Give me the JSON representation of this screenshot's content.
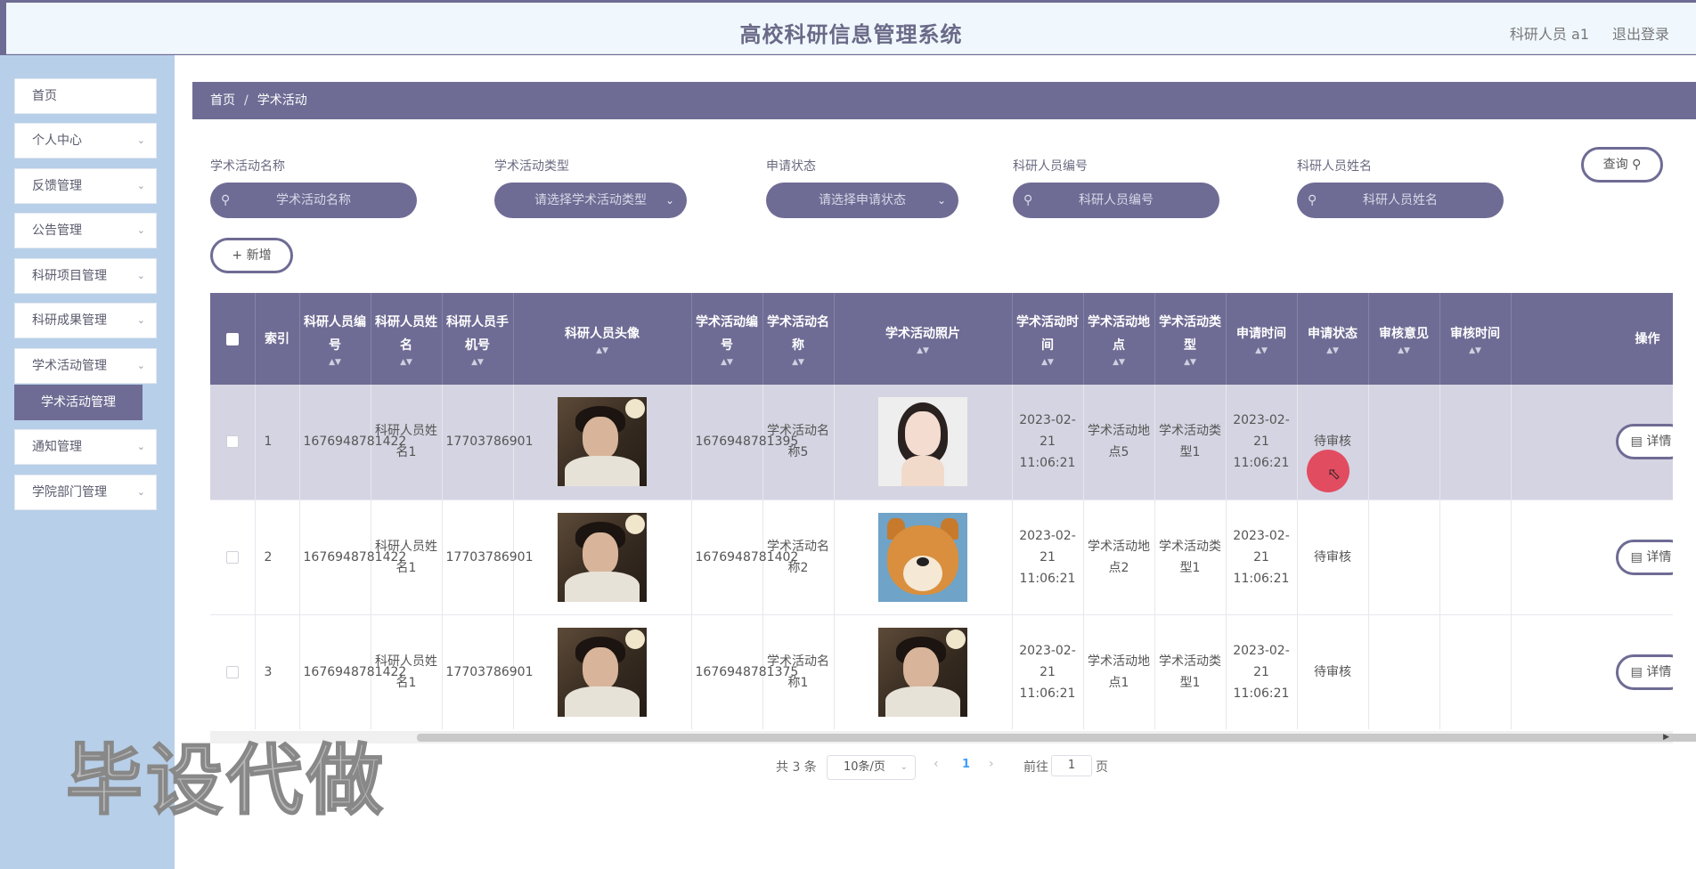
{
  "header": {
    "title": "高校科研信息管理系统",
    "user": "科研人员 a1",
    "logout": "退出登录"
  },
  "sidebar": {
    "items": [
      {
        "label": "首页",
        "has_arrow": false
      },
      {
        "label": "个人中心",
        "has_arrow": true
      },
      {
        "label": "反馈管理",
        "has_arrow": true
      },
      {
        "label": "公告管理",
        "has_arrow": true
      },
      {
        "label": "科研项目管理",
        "has_arrow": true
      },
      {
        "label": "科研成果管理",
        "has_arrow": true
      },
      {
        "label": "学术活动管理",
        "has_arrow": true
      },
      {
        "label": "通知管理",
        "has_arrow": true
      },
      {
        "label": "学院部门管理",
        "has_arrow": true
      }
    ],
    "active_submenu": "学术活动管理"
  },
  "breadcrumb": {
    "home": "首页",
    "sep": "/",
    "current": "学术活动"
  },
  "search": {
    "fields": [
      {
        "label": "学术活动名称",
        "placeholder": "学术活动名称",
        "type": "input"
      },
      {
        "label": "学术活动类型",
        "placeholder": "请选择学术活动类型",
        "type": "select"
      },
      {
        "label": "申请状态",
        "placeholder": "请选择申请状态",
        "type": "select"
      },
      {
        "label": "科研人员编号",
        "placeholder": "科研人员编号",
        "type": "input"
      },
      {
        "label": "科研人员姓名",
        "placeholder": "科研人员姓名",
        "type": "input"
      }
    ],
    "query_label": "查询",
    "add_label": "新增"
  },
  "table": {
    "headers": [
      "索引",
      "科研人员编号",
      "科研人员姓名",
      "科研人员手机号",
      "科研人员头像",
      "学术活动编号",
      "学术活动名称",
      "学术活动照片",
      "学术活动时间",
      "学术活动地点",
      "学术活动类型",
      "申请时间",
      "申请状态",
      "审核意见",
      "审核时间",
      "操作"
    ],
    "rows": [
      {
        "index": "1",
        "staff_no": "1676948781422",
        "staff_name": "科研人员姓名1",
        "phone": "17703786901",
        "act_no": "1676948781395",
        "act_name": "学术活动名称5",
        "photo": "girl",
        "act_time": "2023-02-21 11:06:21",
        "place": "学术活动地点5",
        "type": "学术活动类型1",
        "apply_time": "2023-02-21 11:06:21",
        "status": "待审核",
        "opinion": "",
        "review_time": "",
        "detail": "详情"
      },
      {
        "index": "2",
        "staff_no": "1676948781422",
        "staff_name": "科研人员姓名1",
        "phone": "17703786901",
        "act_no": "1676948781402",
        "act_name": "学术活动名称2",
        "photo": "dog",
        "act_time": "2023-02-21 11:06:21",
        "place": "学术活动地点2",
        "type": "学术活动类型1",
        "apply_time": "2023-02-21 11:06:21",
        "status": "待审核",
        "opinion": "",
        "review_time": "",
        "detail": "详情"
      },
      {
        "index": "3",
        "staff_no": "1676948781422",
        "staff_name": "科研人员姓名1",
        "phone": "17703786901",
        "act_no": "1676948781375",
        "act_name": "学术活动名称1",
        "photo": "boy",
        "act_time": "2023-02-21 11:06:21",
        "place": "学术活动地点1",
        "type": "学术活动类型1",
        "apply_time": "2023-02-21 11:06:21",
        "status": "待审核",
        "opinion": "",
        "review_time": "",
        "detail": "详情"
      }
    ]
  },
  "pagination": {
    "total": "共 3 条",
    "page_size": "10条/页",
    "current_page": "1",
    "goto_label": "前往",
    "goto_value": "1",
    "page_suffix": "页"
  },
  "watermark": "毕设代做",
  "colors": {
    "accent": "#6e6c94",
    "sidebar_bg": "#b7cfe9",
    "header_bg": "#f0f8fe",
    "row_highlight": "#d5d4e2"
  }
}
